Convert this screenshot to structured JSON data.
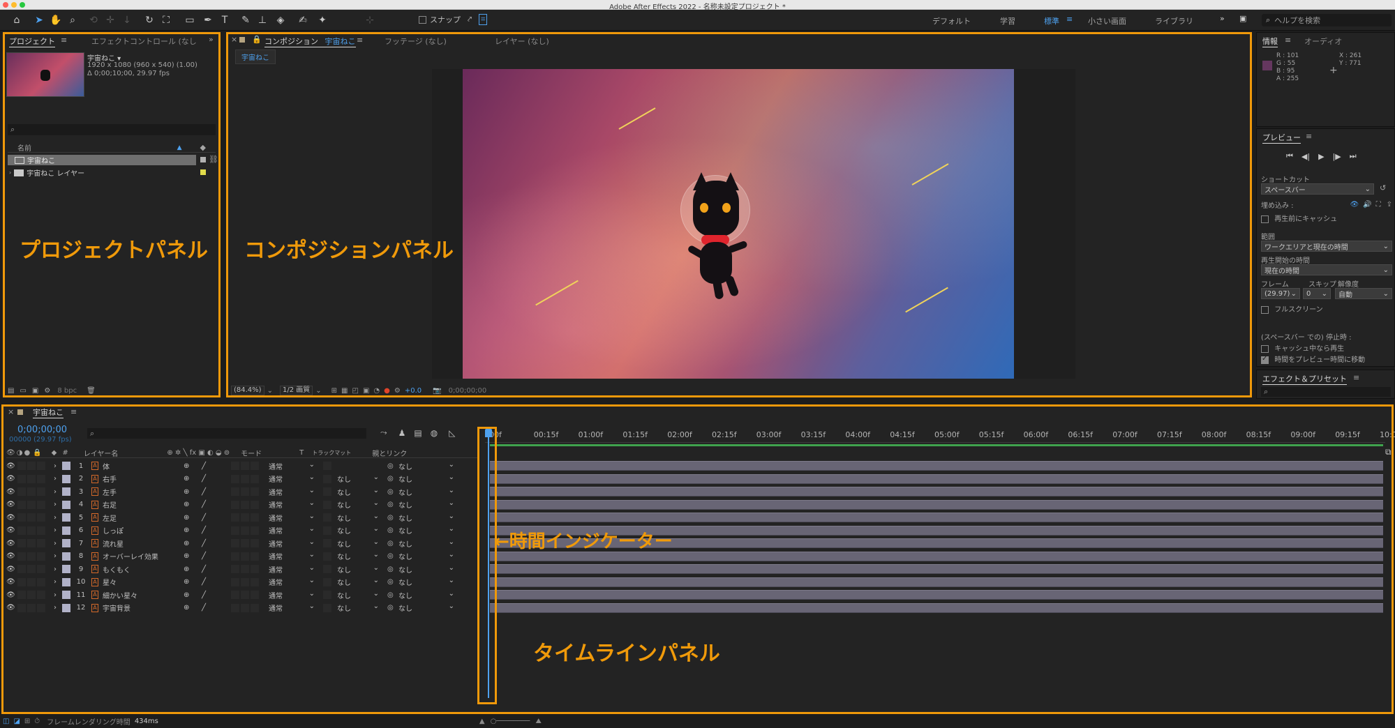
{
  "window": {
    "title": "Adobe After Effects 2022 - 名称未設定プロジェクト *"
  },
  "toolbar": {
    "snap_label": "スナップ",
    "workspaces": [
      "デフォルト",
      "学習",
      "標準",
      "小さい画面",
      "ライブラリ"
    ],
    "active_workspace": "標準",
    "help_placeholder": "ヘルプを検索"
  },
  "project": {
    "tabs": [
      "プロジェクト",
      "エフェクトコントロール (なし"
    ],
    "item_name": "宇宙ねこ ▾",
    "item_res": "1920 x 1080  (960 x 540) (1.00)",
    "item_dur": "Δ 0;00;10;00, 29.97 fps",
    "col_name": "名前",
    "items": [
      "宇宙ねこ",
      "宇宙ねこ レイヤー"
    ],
    "bpc": "8 bpc"
  },
  "composition": {
    "tabs": [
      "コンポジション",
      "フッテージ (なし)",
      "レイヤー (なし)"
    ],
    "comp_name": "宇宙ねこ",
    "breadcrumb": "宇宙ねこ",
    "zoom": "(84.4%)",
    "resolution": "1/2 画質",
    "exposure": "+0.0",
    "timecode": "0;00;00;00"
  },
  "info": {
    "tabs": [
      "情報",
      "オーディオ"
    ],
    "r": "R : 101",
    "g": "G : 55",
    "b": "B : 95",
    "a": "A : 255",
    "x": "X : 261",
    "y": "Y : 771",
    "color": "#65375f"
  },
  "preview": {
    "title": "プレビュー",
    "shortcut_label": "ショートカット",
    "shortcut_value": "スペースバー",
    "embed_label": "埋め込み :",
    "cache_before": "再生前にキャッシュ",
    "range_label": "範囲",
    "range_value": "ワークエリアと現在の時間",
    "start_label": "再生開始の時間",
    "start_value": "現在の時間",
    "frame_label": "フレーム",
    "skip_label": "スキップ",
    "res_label": "解像度",
    "frame_value": "(29.97)",
    "skip_value": "0",
    "res_value": "自動",
    "fullscreen": "フルスクリーン",
    "stop_label": "(スペースバー での) 停止時 :",
    "cache_play": "キャッシュ中なら再生",
    "move_time": "時間をプレビュー時間に移動"
  },
  "effects": {
    "title": "エフェクト＆プリセット"
  },
  "timeline": {
    "tab": "宇宙ねこ",
    "timecode": "0;00;00;00",
    "frames": "00000 (29.97 fps)",
    "col_layer": "レイヤー名",
    "col_mode": "モード",
    "col_t": "T",
    "col_track": "トラックマット",
    "col_parent": "親とリンク",
    "col_num": "#",
    "ticks": [
      "00f",
      "00:15f",
      "01:00f",
      "01:15f",
      "02:00f",
      "02:15f",
      "03:00f",
      "03:15f",
      "04:00f",
      "04:15f",
      "05:00f",
      "05:15f",
      "06:00f",
      "06:15f",
      "07:00f",
      "07:15f",
      "08:00f",
      "08:15f",
      "09:00f",
      "09:15f",
      "10:0"
    ],
    "layers": [
      {
        "num": "1",
        "name": "体",
        "mode": "通常",
        "track": "",
        "parent": "なし"
      },
      {
        "num": "2",
        "name": "右手",
        "mode": "通常",
        "track": "なし",
        "parent": "なし"
      },
      {
        "num": "3",
        "name": "左手",
        "mode": "通常",
        "track": "なし",
        "parent": "なし"
      },
      {
        "num": "4",
        "name": "右足",
        "mode": "通常",
        "track": "なし",
        "parent": "なし"
      },
      {
        "num": "5",
        "name": "左足",
        "mode": "通常",
        "track": "なし",
        "parent": "なし"
      },
      {
        "num": "6",
        "name": "しっぽ",
        "mode": "通常",
        "track": "なし",
        "parent": "なし"
      },
      {
        "num": "7",
        "name": "流れ星",
        "mode": "通常",
        "track": "なし",
        "parent": "なし"
      },
      {
        "num": "8",
        "name": "オーバーレイ効果",
        "mode": "通常",
        "track": "なし",
        "parent": "なし"
      },
      {
        "num": "9",
        "name": "もくもく",
        "mode": "通常",
        "track": "なし",
        "parent": "なし"
      },
      {
        "num": "10",
        "name": "星々",
        "mode": "通常",
        "track": "なし",
        "parent": "なし"
      },
      {
        "num": "11",
        "name": "細かい星々",
        "mode": "通常",
        "track": "なし",
        "parent": "なし"
      },
      {
        "num": "12",
        "name": "宇宙背景",
        "mode": "通常",
        "track": "なし",
        "parent": "なし"
      }
    ],
    "footer": "フレームレンダリング時間",
    "render_ms": "434ms"
  },
  "annotations": {
    "project_panel": "プロジェクトパネル",
    "comp_panel": "コンポジションパネル",
    "time_indicator": "←時間インジケーター",
    "timeline_panel": "タイムラインパネル"
  },
  "colors": {
    "accent": "#f0990a",
    "link_blue": "#4ea1ef",
    "track": "#686575",
    "work_green": "#3fa34d"
  }
}
